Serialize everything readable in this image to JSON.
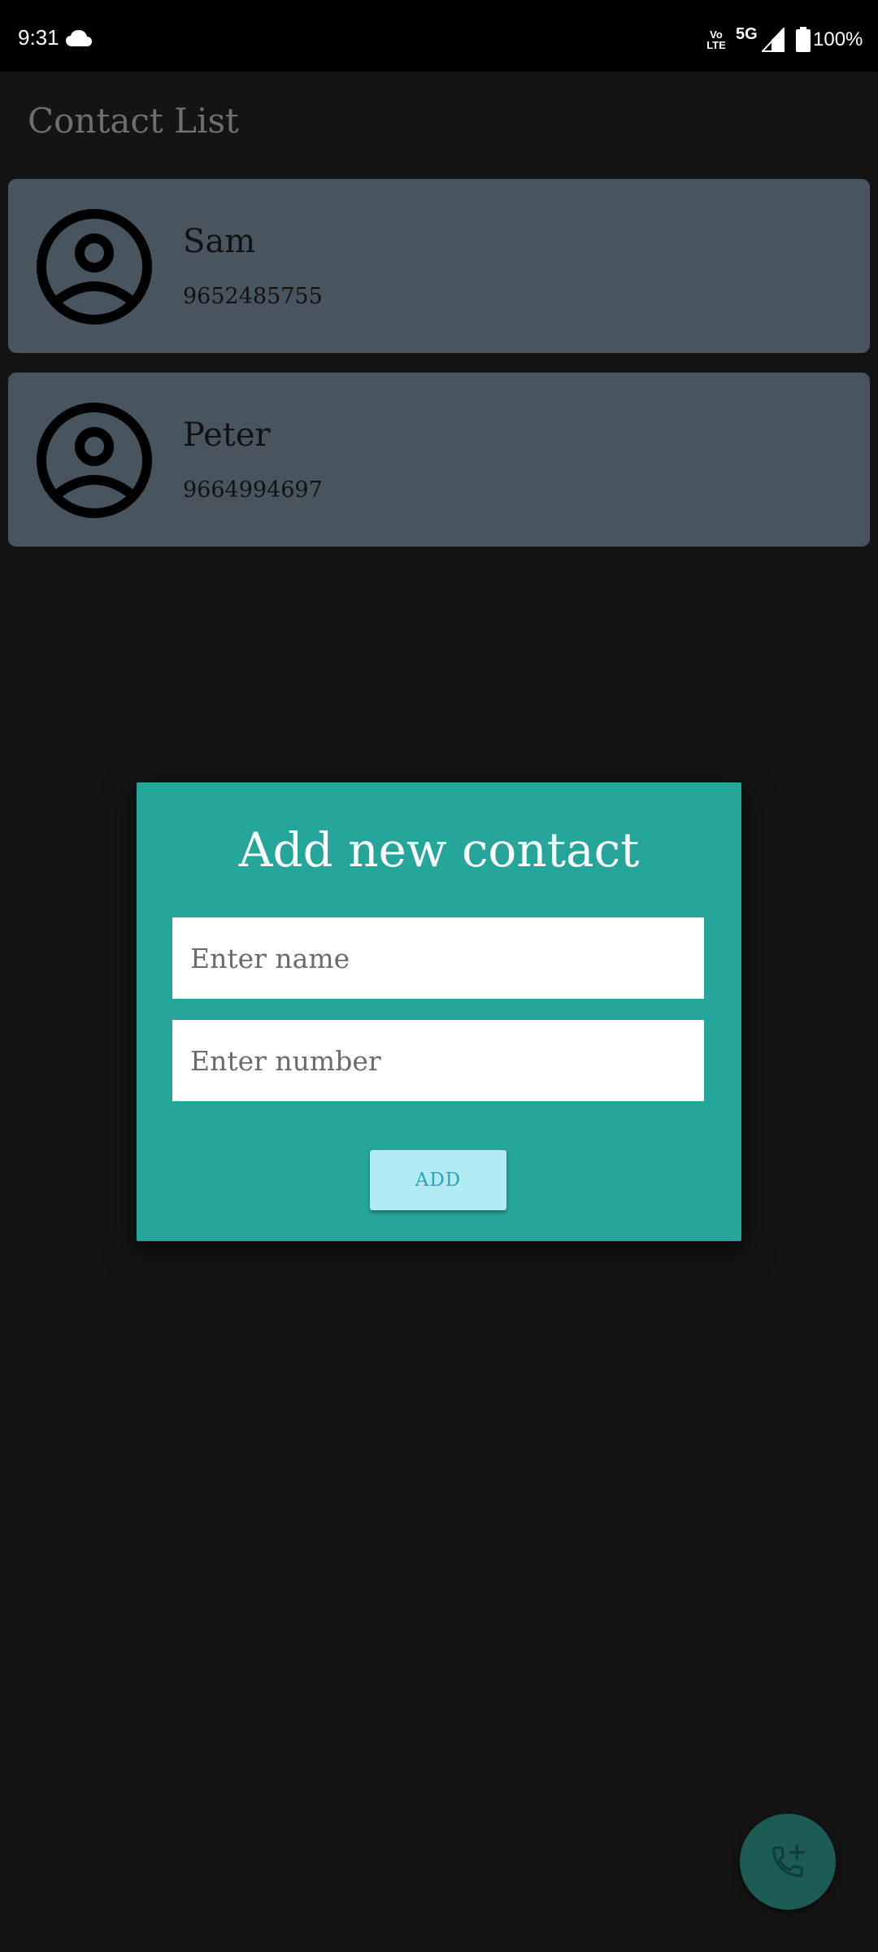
{
  "status_bar": {
    "time": "9:31",
    "volte_label": "Vo LTE",
    "network": "5G",
    "battery": "100%",
    "icons": [
      "cloud-icon",
      "volte-icon",
      "signal-icon",
      "battery-icon"
    ]
  },
  "app_bar": {
    "title": "Contact List"
  },
  "contacts": [
    {
      "name": "Sam",
      "number": "9652485755",
      "icon": "account-circle-icon"
    },
    {
      "name": "Peter",
      "number": "9664994697",
      "icon": "account-circle-icon"
    }
  ],
  "dialog": {
    "title": "Add new contact",
    "name_placeholder": "Enter name",
    "number_placeholder": "Enter number",
    "add_label": "ADD"
  },
  "fab": {
    "icon": "add-call-icon"
  },
  "colors": {
    "background": "#141414",
    "card": "#4a5861",
    "dialog": "#26a69a",
    "button": "#b2ebf2",
    "button_text": "#26a6b8",
    "fab": "#1d5b55"
  }
}
